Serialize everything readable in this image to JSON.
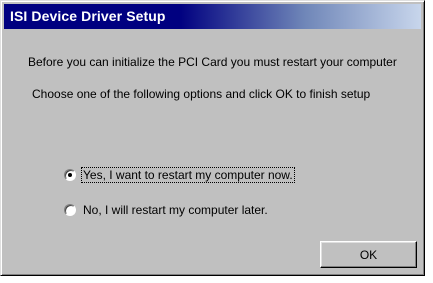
{
  "window": {
    "title": "ISI Device Driver Setup"
  },
  "message": {
    "line1": "Before you can initialize the PCI Card you must restart your computer",
    "line2": "Choose one of the following options and click OK to finish setup"
  },
  "options": [
    {
      "label": "Yes, I want to restart my computer now.",
      "selected": true
    },
    {
      "label": "No, I will restart my computer later.",
      "selected": false
    }
  ],
  "buttons": {
    "ok_label": "OK"
  },
  "colors": {
    "titlebar_start": "#000080",
    "titlebar_end": "#c8d6ec",
    "dialog_face": "#c0c0c0"
  }
}
